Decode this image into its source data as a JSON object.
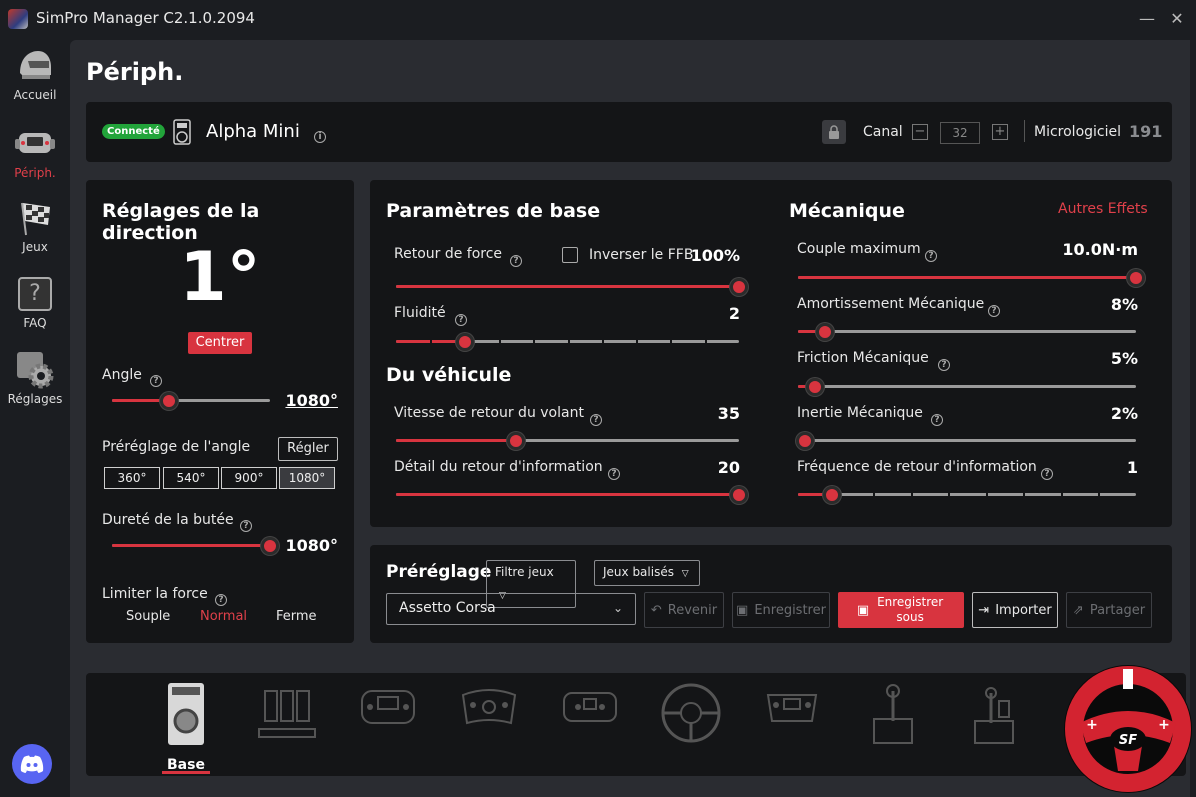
{
  "app": {
    "title": "SimPro Manager C2.1.0.2094"
  },
  "window": {
    "minimize": "—",
    "close": "✕"
  },
  "sidebar": {
    "items": [
      {
        "label": "Accueil",
        "icon": "helmet-icon"
      },
      {
        "label": "Périph.",
        "icon": "steering-wheel-icon",
        "active": true
      },
      {
        "label": "Jeux",
        "icon": "checkered-flag-icon"
      },
      {
        "label": "FAQ",
        "icon": "question-icon"
      },
      {
        "label": "Réglages",
        "icon": "gear-icon"
      }
    ],
    "discord_icon": "discord-icon"
  },
  "page": {
    "title": "Périph."
  },
  "device": {
    "status": "Connecté",
    "name": "Alpha Mini",
    "channel_label": "Canal",
    "channel_value": "32",
    "firmware_label": "Micrologiciel",
    "firmware_value": "191"
  },
  "steering": {
    "title": "Réglages de la direction",
    "angle_display": "1°",
    "center_button": "Centrer",
    "angle_label": "Angle",
    "angle_value": "1080°",
    "angle_fraction": 0.36,
    "preset_label": "Préréglage de l'angle",
    "set_button": "Régler",
    "presets": [
      "360°",
      "540°",
      "900°",
      "1080°"
    ],
    "preset_selected": 3,
    "stop_label": "Dureté de la butée",
    "stop_value": "1080°",
    "stop_fraction": 1.0,
    "force_label": "Limiter la force",
    "force_options": [
      "Souple",
      "Normal",
      "Ferme"
    ],
    "force_selected": 1
  },
  "base_params": {
    "title": "Paramètres de base",
    "ffb_label": "Retour de force",
    "invert_label": "Inverser le FFB",
    "ffb_value": "100%",
    "ffb_fraction": 1.0,
    "smooth_label": "Fluidité",
    "smooth_value": "2",
    "smooth_fraction": 0.2
  },
  "vehicle": {
    "title": "Du véhicule",
    "return_label": "Vitesse de retour du volant",
    "return_value": "35",
    "return_fraction": 0.35,
    "detail_label": "Détail du retour d'information",
    "detail_value": "20",
    "detail_fraction": 1.0
  },
  "mechanics": {
    "title": "Mécanique",
    "other_effects": "Autres Effets",
    "torque_label": "Couple maximum",
    "torque_value": "10.0N·m",
    "torque_fraction": 1.0,
    "damping_label": "Amortissement Mécanique",
    "damping_value": "8%",
    "damping_fraction": 0.08,
    "friction_label": "Friction Mécanique",
    "friction_value": "5%",
    "friction_fraction": 0.05,
    "inertia_label": "Inertie Mécanique",
    "inertia_value": "2%",
    "inertia_fraction": 0.02,
    "freq_label": "Fréquence de retour d'information",
    "freq_value": "1",
    "freq_fraction": 0.1
  },
  "preset": {
    "title": "Préréglage",
    "filter_games": "Filtre jeux",
    "tagged_games": "Jeux balisés",
    "selected_game": "Assetto Corsa",
    "revert": "Revenir",
    "save": "Enregistrer",
    "save_as": "Enregistrer sous",
    "import": "Importer",
    "share": "Partager"
  },
  "device_tabs": {
    "active_label": "Base",
    "icons": [
      "wheelbase-icon",
      "pedals-icon",
      "formula-wheel-icon",
      "gt-wheel-icon",
      "gt-wheel-2-icon",
      "round-wheel-icon",
      "formula-wheel-2-icon",
      "shifter-icon",
      "sequential-shifter-icon",
      "handbrake-icon"
    ]
  },
  "colors": {
    "accent": "#d8343f",
    "connected": "#22a43a",
    "panel": "#141517",
    "background": "#2a2c31"
  }
}
